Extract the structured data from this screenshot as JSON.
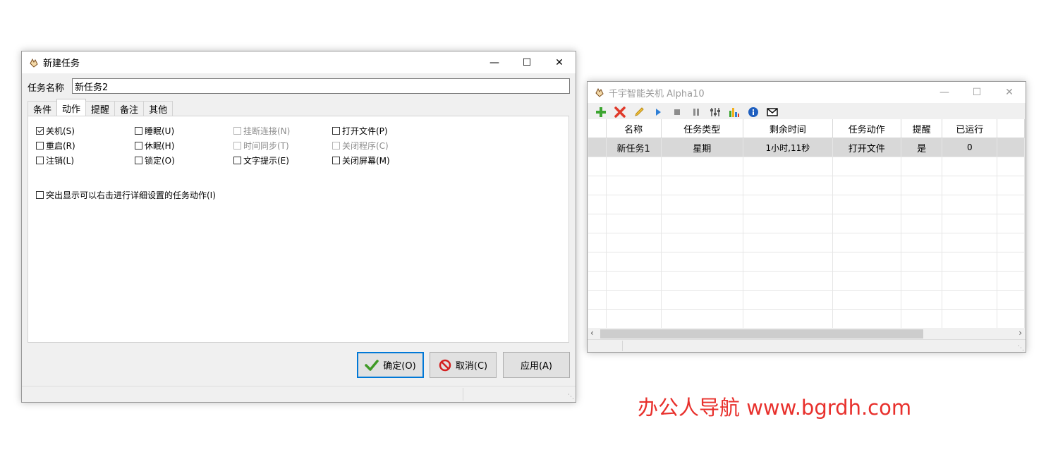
{
  "dialog": {
    "title": "新建任务",
    "task_name_label": "任务名称",
    "task_name_value": "新任务2",
    "tabs": [
      {
        "label": "条件",
        "active": false
      },
      {
        "label": "动作",
        "active": true
      },
      {
        "label": "提醒",
        "active": false
      },
      {
        "label": "备注",
        "active": false
      },
      {
        "label": "其他",
        "active": false
      }
    ],
    "options": {
      "shutdown": "关机(S)",
      "sleep": "睡眠(U)",
      "hangup": "挂断连接(N)",
      "open_file": "打开文件(P)",
      "restart": "重启(R)",
      "hibernate": "休眠(H)",
      "time_sync": "时间同步(T)",
      "close_program": "关闭程序(C)",
      "logoff": "注销(L)",
      "lock": "锁定(O)",
      "text_prompt": "文字提示(E)",
      "close_screen": "关闭屏幕(M)",
      "highlight": "突出显示可以右击进行详细设置的任务动作(I)"
    },
    "buttons": {
      "ok": "确定(O)",
      "cancel": "取消(C)",
      "apply": "应用(A)"
    }
  },
  "main": {
    "title": "千宇智能关机 Alpha10",
    "columns": [
      "名称",
      "任务类型",
      "剩余时间",
      "任务动作",
      "提醒",
      "已运行"
    ],
    "rows": [
      {
        "name": "新任务1",
        "type": "星期",
        "remaining": "1小时,11秒",
        "action": "打开文件",
        "remind": "是",
        "ran": "0"
      }
    ],
    "toolbar": [
      "add-icon",
      "delete-icon",
      "edit-icon",
      "play-icon",
      "stop-icon",
      "pause-icon",
      "tools-icon",
      "chart-icon",
      "info-icon",
      "mail-icon"
    ]
  },
  "watermark": "办公人导航  www.bgrdh.com",
  "colors": {
    "accent": "#0078d7",
    "watermark": "#e8302c",
    "selection": "#d8d8d8"
  }
}
